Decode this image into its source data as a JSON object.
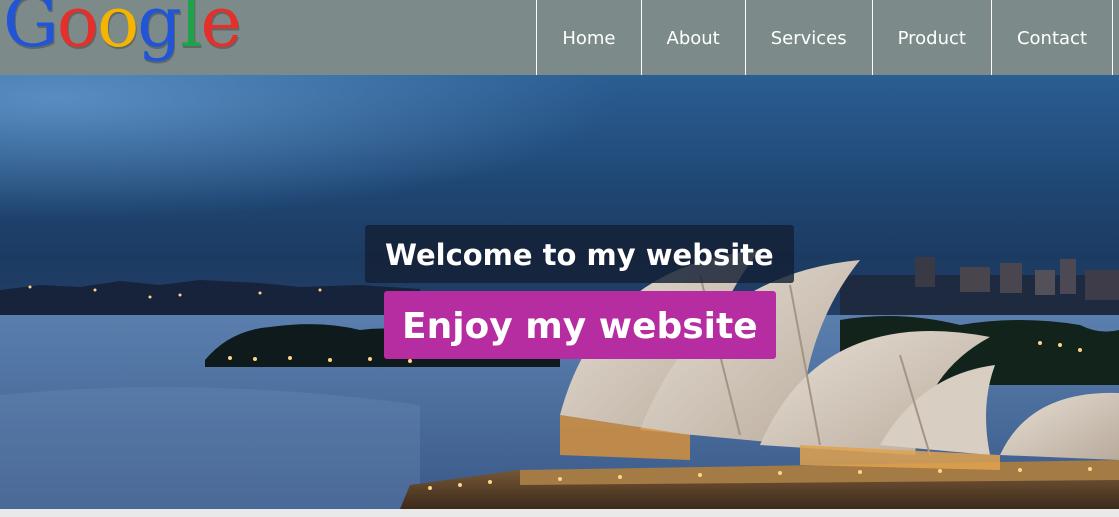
{
  "logo": {
    "letters": [
      "G",
      "o",
      "o",
      "g",
      "l",
      "e"
    ],
    "colors": [
      "#2255d6",
      "#e42f2a",
      "#f4b400",
      "#2255d6",
      "#1fa24a",
      "#e42f2a"
    ]
  },
  "nav": {
    "items": [
      {
        "label": "Home"
      },
      {
        "label": "About"
      },
      {
        "label": "Services"
      },
      {
        "label": "Product"
      },
      {
        "label": "Contact"
      }
    ]
  },
  "hero": {
    "welcome_text": "Welcome to my website",
    "enjoy_text": "Enjoy my website"
  },
  "colors": {
    "navbar": "#7c8b8a",
    "welcome_bg": "#142034",
    "enjoy_bg": "#b52da0"
  }
}
